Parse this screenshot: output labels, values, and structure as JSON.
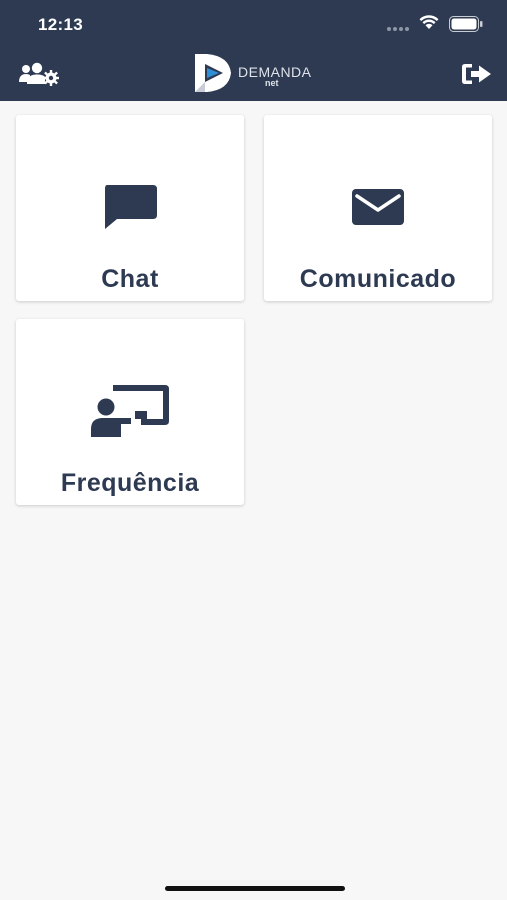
{
  "status_bar": {
    "time": "12:13"
  },
  "header": {
    "logo_text": "DEMANDA",
    "logo_sub": "net",
    "left_icon": "users-gear-icon",
    "right_icon": "sign-out-icon",
    "background": "#2d3a52"
  },
  "cards": [
    {
      "label": "Chat",
      "icon": "chat-bubble-icon"
    },
    {
      "label": "Comunicado",
      "icon": "envelope-icon"
    },
    {
      "label": "Frequência",
      "icon": "chalkboard-teacher-icon"
    }
  ],
  "colors": {
    "primary": "#2d3a52",
    "background": "#f7f7f7",
    "card": "#ffffff",
    "logo_accent": "#2f8fd6"
  }
}
